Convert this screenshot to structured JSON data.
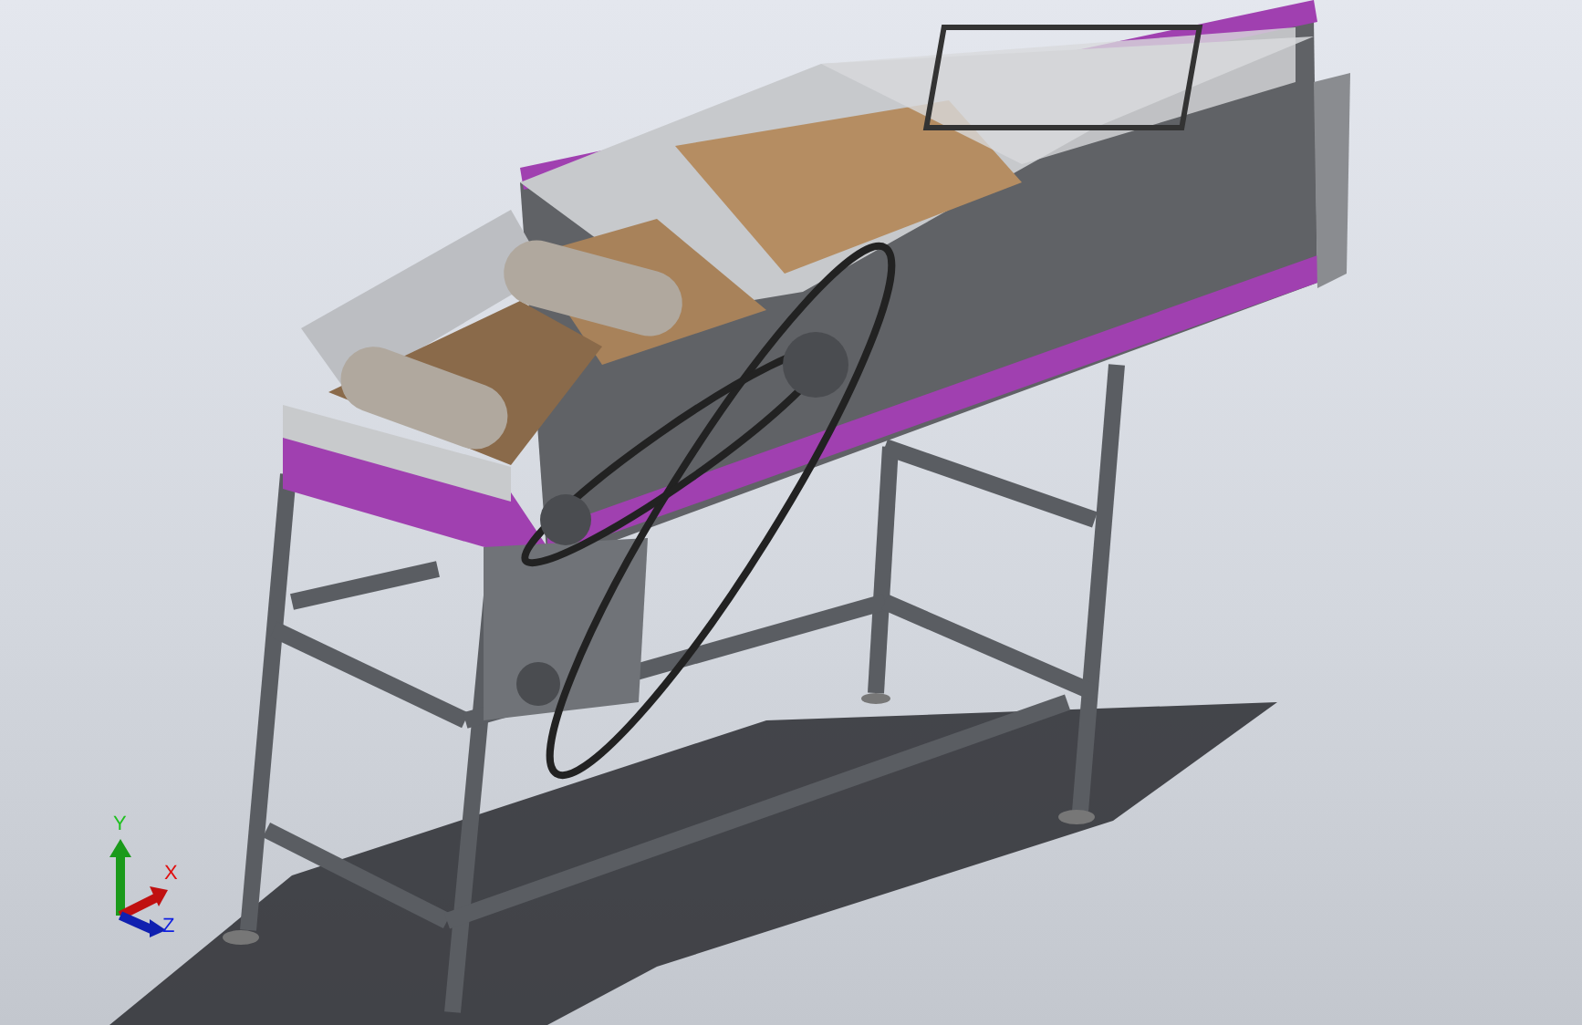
{
  "triad": {
    "axes": [
      {
        "label": "Y",
        "color": "#1fc01f"
      },
      {
        "label": "X",
        "color": "#e01010"
      },
      {
        "label": "Z",
        "color": "#1020e0"
      }
    ]
  }
}
